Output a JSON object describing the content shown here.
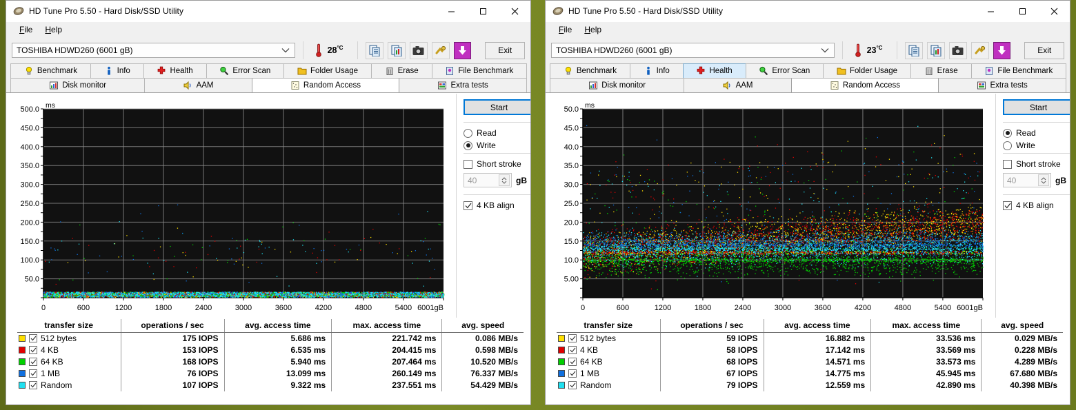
{
  "desktop": {
    "background": "#6b7a1e"
  },
  "windows": [
    {
      "id": "left",
      "title": "HD Tune Pro 5.50 - Hard Disk/SSD Utility",
      "title_icon": "hard-disk-icon",
      "menu": [
        "File",
        "Help"
      ],
      "drive": "TOSHIBA HDWD260 (6001 gB)",
      "temperature": "28",
      "temperature_unit": "°C",
      "exit_label": "Exit",
      "tabs_row1": [
        {
          "label": "Benchmark",
          "icon": "bulb-icon",
          "state": "normal"
        },
        {
          "label": "Info",
          "icon": "info-icon",
          "state": "normal"
        },
        {
          "label": "Health",
          "icon": "cross-icon",
          "state": "normal"
        },
        {
          "label": "Error Scan",
          "icon": "magnifier-icon",
          "state": "normal"
        },
        {
          "label": "Folder Usage",
          "icon": "folder-icon",
          "state": "normal"
        },
        {
          "label": "Erase",
          "icon": "trash-icon",
          "state": "normal"
        },
        {
          "label": "File Benchmark",
          "icon": "file-icon",
          "state": "normal"
        }
      ],
      "tabs_row2": [
        {
          "label": "Disk monitor",
          "icon": "chart-icon",
          "state": "normal"
        },
        {
          "label": "AAM",
          "icon": "speaker-icon",
          "state": "normal"
        },
        {
          "label": "Random Access",
          "icon": "random-icon",
          "state": "active"
        },
        {
          "label": "Extra tests",
          "icon": "grid-icon",
          "state": "normal"
        }
      ],
      "panel": {
        "start_label": "Start",
        "read_label": "Read",
        "write_label": "Write",
        "mode_selected": "Write",
        "short_stroke_label": "Short stroke",
        "short_stroke_checked": false,
        "short_stroke_value": "40",
        "short_stroke_unit": "gB",
        "align_label": "4 KB align",
        "align_checked": true
      },
      "table": {
        "headers": [
          "transfer size",
          "operations / sec",
          "avg. access time",
          "max. access time",
          "avg. speed"
        ],
        "rows": [
          {
            "color": "#ffe000",
            "checked": true,
            "name": "512 bytes",
            "iops": "175 IOPS",
            "avg_access": "5.686 ms",
            "max_access": "221.742 ms",
            "avg_speed": "0.086 MB/s"
          },
          {
            "color": "#e00000",
            "checked": true,
            "name": "4 KB",
            "iops": "153 IOPS",
            "avg_access": "6.535 ms",
            "max_access": "204.415 ms",
            "avg_speed": "0.598 MB/s"
          },
          {
            "color": "#00d000",
            "checked": true,
            "name": "64 KB",
            "iops": "168 IOPS",
            "avg_access": "5.940 ms",
            "max_access": "207.464 ms",
            "avg_speed": "10.520 MB/s"
          },
          {
            "color": "#1070e0",
            "checked": true,
            "name": "1 MB",
            "iops": "76 IOPS",
            "avg_access": "13.099 ms",
            "max_access": "260.149 ms",
            "avg_speed": "76.337 MB/s"
          },
          {
            "color": "#20e0f0",
            "checked": true,
            "name": "Random",
            "iops": "107 IOPS",
            "avg_access": "9.322 ms",
            "max_access": "237.551 ms",
            "avg_speed": "54.429 MB/s"
          }
        ]
      },
      "chart_data": {
        "type": "scatter",
        "title": "",
        "ylabel": "ms",
        "xlabel": "gB",
        "ylim": [
          0,
          500
        ],
        "xlim": [
          0,
          6001
        ],
        "yticks": [
          "50.0",
          "100.0",
          "150.0",
          "200.0",
          "250.0",
          "300.0",
          "350.0",
          "400.0",
          "450.0",
          "500.0"
        ],
        "ytick_values": [
          50,
          100,
          150,
          200,
          250,
          300,
          350,
          400,
          450,
          500
        ],
        "xticks": [
          "0",
          "600",
          "1200",
          "1800",
          "2400",
          "3000",
          "3600",
          "4200",
          "4800",
          "5400",
          "6001gB"
        ],
        "xtick_values": [
          0,
          600,
          1200,
          1800,
          2400,
          3000,
          3600,
          4200,
          4800,
          5400,
          6001
        ],
        "grid": true,
        "plot_bg": "#111111",
        "grid_color": "#8a8a8a",
        "legend_position": "below-as-table",
        "series": [
          {
            "name": "512 bytes",
            "color": "#ffe000",
            "band_center": 6,
            "band_spread": 4,
            "outlier_rate": 0.04,
            "outlier_max": 240
          },
          {
            "name": "4 KB",
            "color": "#e00000",
            "band_center": 7,
            "band_spread": 4,
            "outlier_rate": 0.04,
            "outlier_max": 210
          },
          {
            "name": "64 KB",
            "color": "#00d000",
            "band_center": 6,
            "band_spread": 4,
            "outlier_rate": 0.04,
            "outlier_max": 210
          },
          {
            "name": "1 MB",
            "color": "#1070e0",
            "band_center": 13,
            "band_spread": 6,
            "outlier_rate": 0.05,
            "outlier_max": 260
          },
          {
            "name": "Random",
            "color": "#20e0f0",
            "band_center": 9,
            "band_spread": 5,
            "outlier_rate": 0.05,
            "outlier_max": 240
          }
        ]
      }
    },
    {
      "id": "right",
      "title": "HD Tune Pro 5.50 - Hard Disk/SSD Utility",
      "title_icon": "hard-disk-icon",
      "menu": [
        "File",
        "Help"
      ],
      "drive": "TOSHIBA HDWD260 (6001 gB)",
      "temperature": "23",
      "temperature_unit": "°C",
      "exit_label": "Exit",
      "tabs_row1": [
        {
          "label": "Benchmark",
          "icon": "bulb-icon",
          "state": "normal"
        },
        {
          "label": "Info",
          "icon": "info-icon",
          "state": "normal"
        },
        {
          "label": "Health",
          "icon": "cross-icon",
          "state": "hover"
        },
        {
          "label": "Error Scan",
          "icon": "magnifier-icon",
          "state": "normal"
        },
        {
          "label": "Folder Usage",
          "icon": "folder-icon",
          "state": "normal"
        },
        {
          "label": "Erase",
          "icon": "trash-icon",
          "state": "normal"
        },
        {
          "label": "File Benchmark",
          "icon": "file-icon",
          "state": "normal"
        }
      ],
      "tabs_row2": [
        {
          "label": "Disk monitor",
          "icon": "chart-icon",
          "state": "normal"
        },
        {
          "label": "AAM",
          "icon": "speaker-icon",
          "state": "normal"
        },
        {
          "label": "Random Access",
          "icon": "random-icon",
          "state": "active"
        },
        {
          "label": "Extra tests",
          "icon": "grid-icon",
          "state": "normal"
        }
      ],
      "panel": {
        "start_label": "Start",
        "read_label": "Read",
        "write_label": "Write",
        "mode_selected": "Read",
        "short_stroke_label": "Short stroke",
        "short_stroke_checked": false,
        "short_stroke_value": "40",
        "short_stroke_unit": "gB",
        "align_label": "4 KB align",
        "align_checked": true
      },
      "table": {
        "headers": [
          "transfer size",
          "operations / sec",
          "avg. access time",
          "max. access time",
          "avg. speed"
        ],
        "rows": [
          {
            "color": "#ffe000",
            "checked": true,
            "name": "512 bytes",
            "iops": "59 IOPS",
            "avg_access": "16.882 ms",
            "max_access": "33.536 ms",
            "avg_speed": "0.029 MB/s"
          },
          {
            "color": "#e00000",
            "checked": true,
            "name": "4 KB",
            "iops": "58 IOPS",
            "avg_access": "17.142 ms",
            "max_access": "33.569 ms",
            "avg_speed": "0.228 MB/s"
          },
          {
            "color": "#00d000",
            "checked": true,
            "name": "64 KB",
            "iops": "68 IOPS",
            "avg_access": "14.571 ms",
            "max_access": "33.573 ms",
            "avg_speed": "4.289 MB/s"
          },
          {
            "color": "#1070e0",
            "checked": true,
            "name": "1 MB",
            "iops": "67 IOPS",
            "avg_access": "14.775 ms",
            "max_access": "45.945 ms",
            "avg_speed": "67.680 MB/s"
          },
          {
            "color": "#20e0f0",
            "checked": true,
            "name": "Random",
            "iops": "79 IOPS",
            "avg_access": "12.559 ms",
            "max_access": "42.890 ms",
            "avg_speed": "40.398 MB/s"
          }
        ]
      },
      "chart_data": {
        "type": "scatter",
        "title": "",
        "ylabel": "ms",
        "xlabel": "gB",
        "ylim": [
          0,
          50
        ],
        "xlim": [
          0,
          6001
        ],
        "yticks": [
          "5.00",
          "10.0",
          "15.0",
          "20.0",
          "25.0",
          "30.0",
          "35.0",
          "40.0",
          "45.0",
          "50.0"
        ],
        "ytick_values": [
          5,
          10,
          15,
          20,
          25,
          30,
          35,
          40,
          45,
          50
        ],
        "xticks": [
          "0",
          "600",
          "1200",
          "1800",
          "2400",
          "3000",
          "3600",
          "4200",
          "4800",
          "5400",
          "6001gB"
        ],
        "xtick_values": [
          0,
          600,
          1200,
          1800,
          2400,
          3000,
          3600,
          4200,
          4800,
          5400,
          6001
        ],
        "grid": true,
        "plot_bg": "#111111",
        "grid_color": "#8a8a8a",
        "legend_position": "below-as-table",
        "series": [
          {
            "name": "512 bytes",
            "color": "#ffe000",
            "band_start": 12,
            "band_end": 20,
            "spread": 5,
            "density": 1.0
          },
          {
            "name": "4 KB",
            "color": "#e00000",
            "band_start": 12,
            "band_end": 20,
            "spread": 5,
            "density": 1.0
          },
          {
            "name": "64 KB",
            "color": "#00d000",
            "band_start": 10,
            "band_end": 10,
            "spread": 4,
            "density": 1.0
          },
          {
            "name": "1 MB",
            "color": "#1070e0",
            "band_start": 14,
            "band_end": 14.5,
            "spread": 3,
            "density": 1.0
          },
          {
            "name": "Random",
            "color": "#20e0f0",
            "band_start": 13,
            "band_end": 13.5,
            "spread": 4,
            "density": 1.0
          }
        ]
      }
    }
  ]
}
